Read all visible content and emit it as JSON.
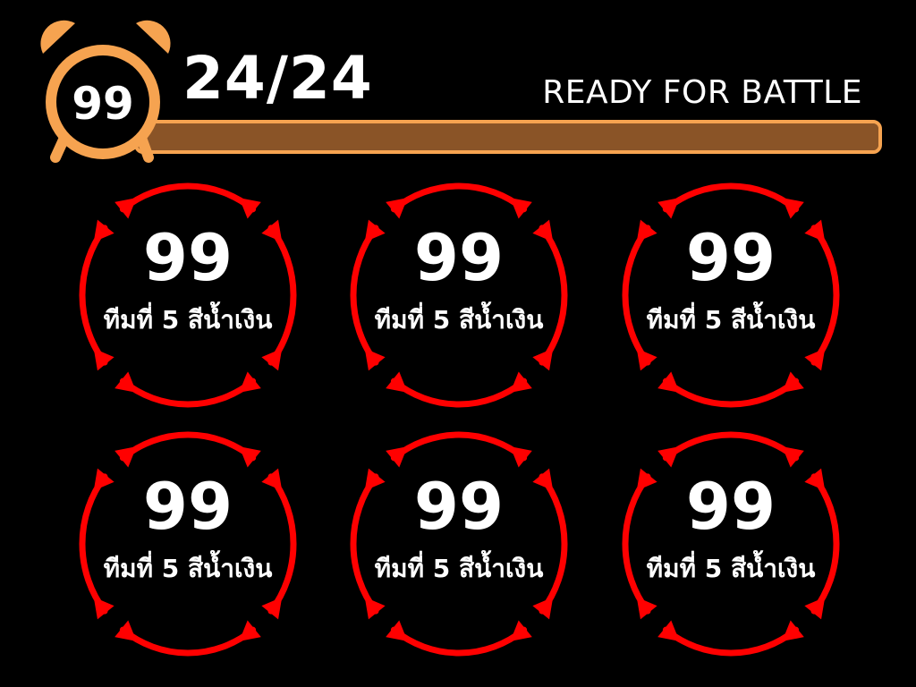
{
  "header": {
    "timer_value": "99",
    "round_counter": "24/24",
    "status": "READY FOR BATTLE",
    "progress": 1.0,
    "clock_icon": "alarm-clock-icon"
  },
  "colors": {
    "background": "#000000",
    "clock_orange": "#f6a350",
    "progress_fill": "#8a5427",
    "ring_red": "#ff0000",
    "text": "#ffffff"
  },
  "teams": [
    {
      "score": "99",
      "label": "ทีมที่ 5 สีน้ำเงิน"
    },
    {
      "score": "99",
      "label": "ทีมที่ 5 สีน้ำเงิน"
    },
    {
      "score": "99",
      "label": "ทีมที่ 5 สีน้ำเงิน"
    },
    {
      "score": "99",
      "label": "ทีมที่ 5 สีน้ำเงิน"
    },
    {
      "score": "99",
      "label": "ทีมที่ 5 สีน้ำเงิน"
    },
    {
      "score": "99",
      "label": "ทีมที่ 5 สีน้ำเงิน"
    }
  ]
}
